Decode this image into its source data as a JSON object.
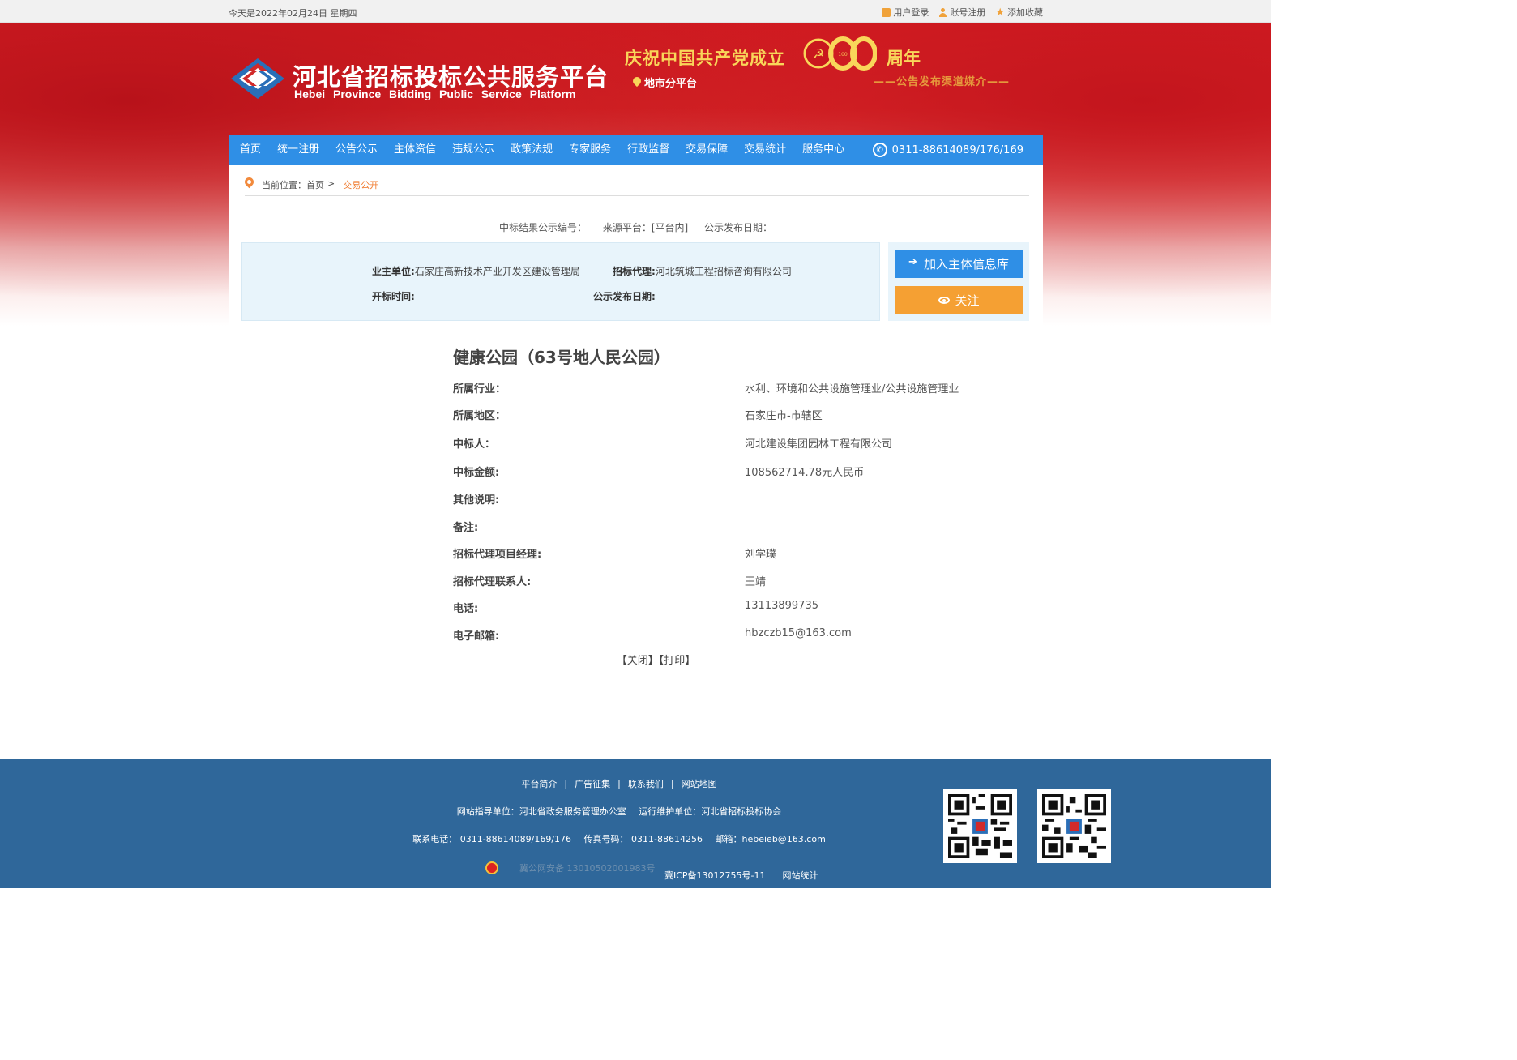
{
  "topbar": {
    "date": "今天是2022年02月24日 星期四",
    "login": "用户登录",
    "register": "账号注册",
    "favorite": "添加收藏"
  },
  "header": {
    "title": "河北省招标投标公共服务平台",
    "subtitle_en": "Hebei Province Bidding Public Service Platform",
    "celebrate": "庆祝中国共产党成立",
    "hundred": "100",
    "anniversary": "周年",
    "branch": "地市分平台",
    "right_sub": "——公告发布渠道媒介——"
  },
  "nav": {
    "items": [
      "首页",
      "统一注册",
      "公告公示",
      "主体资信",
      "违规公示",
      "政策法规",
      "专家服务",
      "行政监督",
      "交易保障",
      "交易统计",
      "服务中心"
    ],
    "phone": "0311-88614089/176/169"
  },
  "breadcrumb": {
    "prefix": "当前位置：",
    "home": "首页",
    "separator": ">",
    "current": "交易公开"
  },
  "meta": {
    "notice_no": "中标结果公示编号：",
    "source": "来源平台：[平台内]",
    "publish_date": "公示发布日期："
  },
  "info": {
    "owner_label": "业主单位:",
    "owner_value": "石家庄高新技术产业开发区建设管理局",
    "agent_label": "招标代理:",
    "agent_value": "河北筑城工程招标咨询有限公司",
    "open_time_label": "开标时间:",
    "publish_date_label": "公示发布日期:"
  },
  "buttons": {
    "join": "加入主体信息库",
    "follow": "关注"
  },
  "project": {
    "title": "健康公园（63号地人民公园）",
    "rows": [
      {
        "label": "所属行业：",
        "value": "水利、环境和公共设施管理业/公共设施管理业"
      },
      {
        "label": "所属地区：",
        "value": "石家庄市-市辖区"
      },
      {
        "label": "中标人：",
        "value": "河北建设集团园林工程有限公司"
      },
      {
        "label": "中标金额:",
        "value": "108562714.78元人民币"
      },
      {
        "label": "其他说明:",
        "value": ""
      },
      {
        "label": "备注:",
        "value": ""
      },
      {
        "label": "招标代理项目经理:",
        "value": "刘学璞"
      },
      {
        "label": "招标代理联系人:",
        "value": "王靖"
      },
      {
        "label": "电话:",
        "value": "13113899735"
      },
      {
        "label": "电子邮箱:",
        "value": "hbzczb15@163.com"
      }
    ]
  },
  "actions": {
    "close": "【关闭】",
    "print": "【打印】"
  },
  "footer": {
    "links": [
      "平台简介",
      "广告征集",
      "联系我们",
      "网站地图"
    ],
    "separator": "|",
    "guide": "网站指导单位：河北省政务服务管理办公室",
    "maintain": "运行维护单位：河北省招标投标协会",
    "phone": "联系电话： 0311-88614089/169/176",
    "fax": "传真号码： 0311-88614256",
    "email": "邮箱：hebeieb@163.com",
    "police": "冀公网安备 13010502001983号",
    "icp": "冀ICP备13012755号-11",
    "stats": "网站统计"
  },
  "colors": {
    "nav_blue": "#2f8fe6",
    "follow_orange": "#f5a033",
    "footer_blue": "#2f679a",
    "banner_red": "#d81e23",
    "gold": "#f9d65a"
  }
}
